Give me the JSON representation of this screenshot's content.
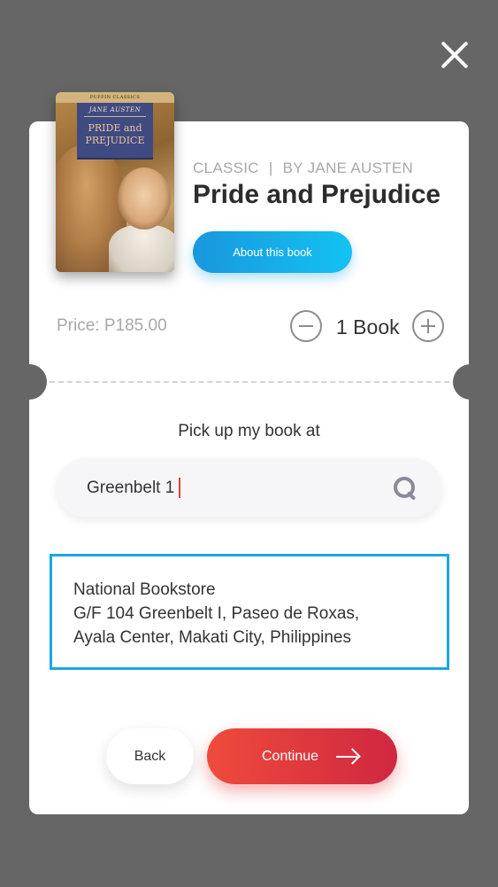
{
  "close": {
    "icon": "close-icon"
  },
  "book": {
    "genre": "CLASSIC",
    "separator": "|",
    "author_line": "BY JANE AUSTEN",
    "title": "Pride and Prejudice",
    "about_label": "About this book",
    "cover": {
      "series": "PUFFIN CLASSICS",
      "author": "JANE AUSTEN",
      "title_line1": "PRIDE and",
      "title_line2": "PREJUDICE"
    }
  },
  "order": {
    "price": "Price: P185.00",
    "quantity_label": "1 Book",
    "minus_icon": "minus-circle-icon",
    "plus_icon": "plus-circle-icon"
  },
  "pickup": {
    "label": "Pick up my book at",
    "search_value": "Greenbelt 1",
    "search_icon": "search-icon",
    "result": {
      "line1": "National Bookstore",
      "line2": "G/F 104 Greenbelt I, Paseo de Roxas,",
      "line3": "Ayala Center, Makati City, Philippines"
    }
  },
  "actions": {
    "back_label": "Back",
    "continue_label": "Continue",
    "continue_icon": "arrow-right-icon"
  },
  "colors": {
    "overlay": "#666666",
    "accent_blue": "#14C2F2",
    "accent_red": "#E53E3E"
  }
}
